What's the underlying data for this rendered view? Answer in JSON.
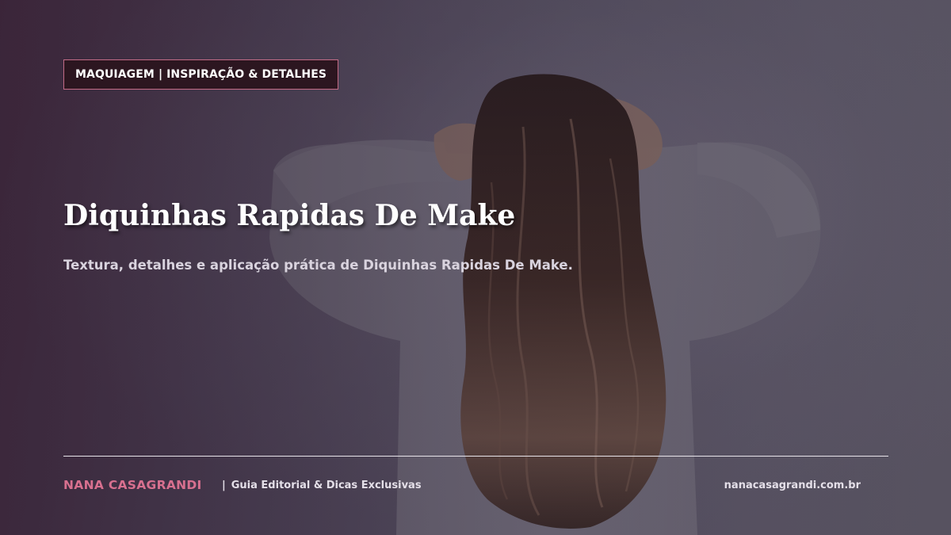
{
  "tag": {
    "label": "MAQUIAGEM | INSPIRAÇÃO & DETALHES"
  },
  "hero": {
    "title": "Diquinhas Rapidas De Make",
    "subtitle": "Textura, detalhes e aplicação prática de Diquinhas Rapidas De Make."
  },
  "footer": {
    "brand": "NANA CASAGRANDI",
    "separator": "|",
    "tagline": "Guia Editorial & Dicas Exclusivas",
    "site": "nanacasagrandi.com.br"
  },
  "colors": {
    "accent": "#d8708f",
    "tag_background": "#2c1620",
    "tag_border": "#c26b86"
  },
  "image": {
    "subject": "woman-with-long-wavy-hair-from-behind"
  }
}
